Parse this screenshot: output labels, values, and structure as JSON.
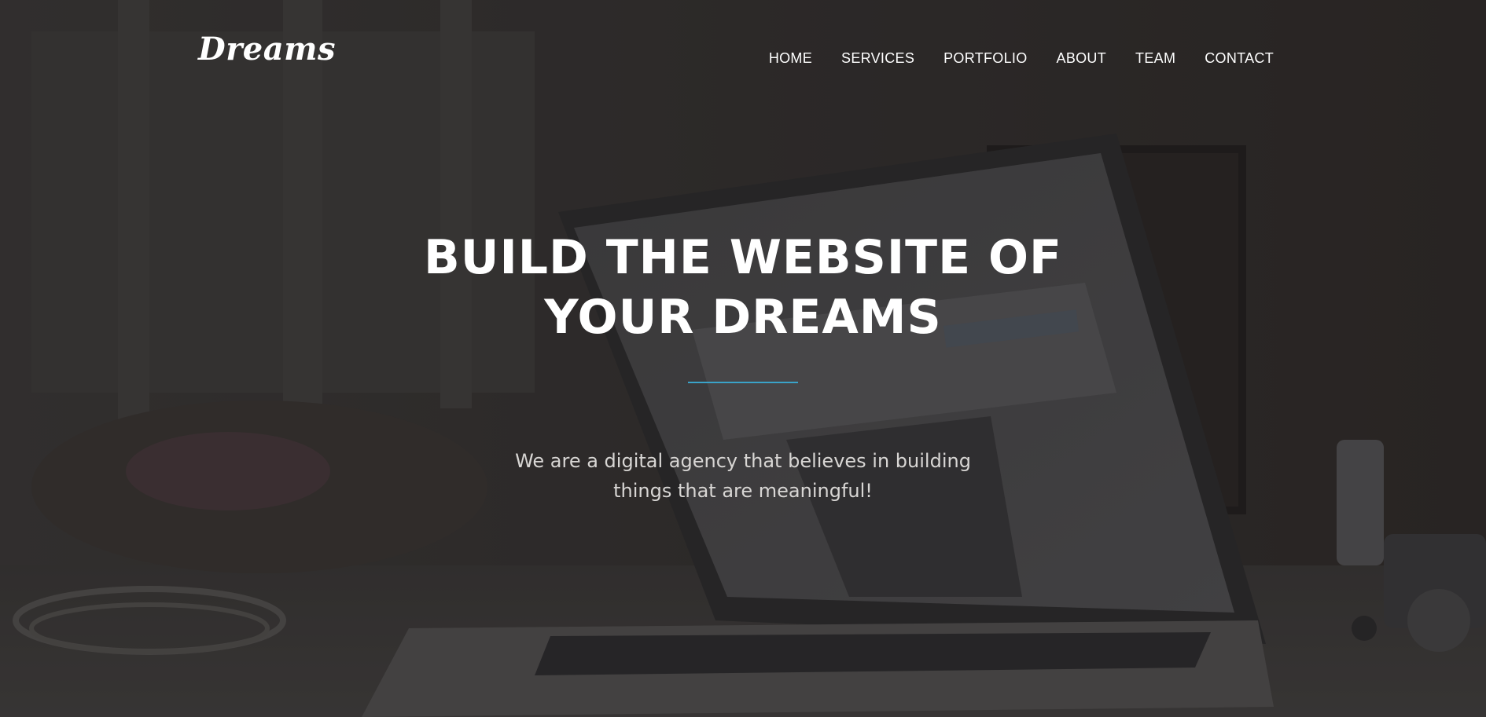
{
  "brand": {
    "logo_text": "Dreams"
  },
  "nav": {
    "items": [
      {
        "label": "HOME"
      },
      {
        "label": "SERVICES"
      },
      {
        "label": "PORTFOLIO"
      },
      {
        "label": "ABOUT"
      },
      {
        "label": "TEAM"
      },
      {
        "label": "CONTACT"
      }
    ]
  },
  "hero": {
    "title_line1": "BUILD THE WEBSITE OF",
    "title_line2": "YOUR DREAMS",
    "subtitle_line1": "We are a digital agency that believes in building",
    "subtitle_line2": "things that are meaningful!",
    "background_image": "laptop-on-desk-photo"
  },
  "colors": {
    "overlay": "#2e2b2a",
    "text": "#ffffff",
    "subtitle": "#d8d6d4",
    "accent": "#3aa3c9"
  }
}
